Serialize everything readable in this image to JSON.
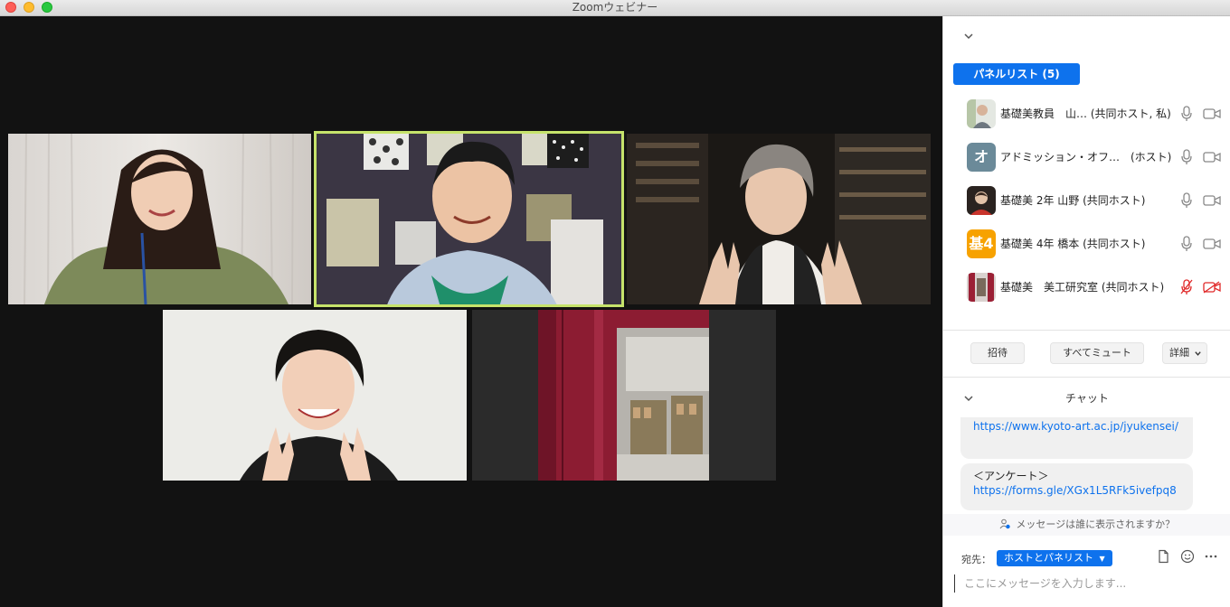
{
  "window": {
    "title": "Zoomウェビナー"
  },
  "panelists": {
    "tab_label": "パネルリスト (5)",
    "items": [
      {
        "name": "基礎美教員　山… (共同ホスト, 私)",
        "avatar": "photo",
        "mic_muted": false,
        "cam_off": false
      },
      {
        "name": "アドミッション・オフ…　(ホスト)",
        "avatar": "オ",
        "mic_muted": false,
        "cam_off": false
      },
      {
        "name": "基礎美 2年 山野 (共同ホスト)",
        "avatar": "photo",
        "mic_muted": false,
        "cam_off": false
      },
      {
        "name": "基礎美 4年 橋本 (共同ホスト)",
        "avatar": "基4",
        "mic_muted": false,
        "cam_off": false
      },
      {
        "name": "基礎美　美工研究室 (共同ホスト)",
        "avatar": "photo",
        "mic_muted": true,
        "cam_off": true
      }
    ],
    "invite_label": "招待",
    "mute_all_label": "すべてミュート",
    "more_label": "詳細"
  },
  "chat": {
    "title": "チャット",
    "messages": [
      {
        "text": "",
        "link": "https://www.kyoto-art.ac.jp/jyukensei/"
      },
      {
        "text": "＜アンケート＞",
        "link": "https://forms.gle/XGx1L5RFk5ivefpq8"
      }
    ],
    "who_can_see": "メッセージは誰に表示されますか？",
    "to_label": "宛先：",
    "to_value": "ホストとパネリスト",
    "input_placeholder": "ここにメッセージを入力します..."
  },
  "colors": {
    "accent": "#0e72ed",
    "active_speaker": "#c6e36b",
    "muted_red": "#e02828",
    "avatar_o": "#6b8a99",
    "avatar_ki4": "#f7a200"
  }
}
